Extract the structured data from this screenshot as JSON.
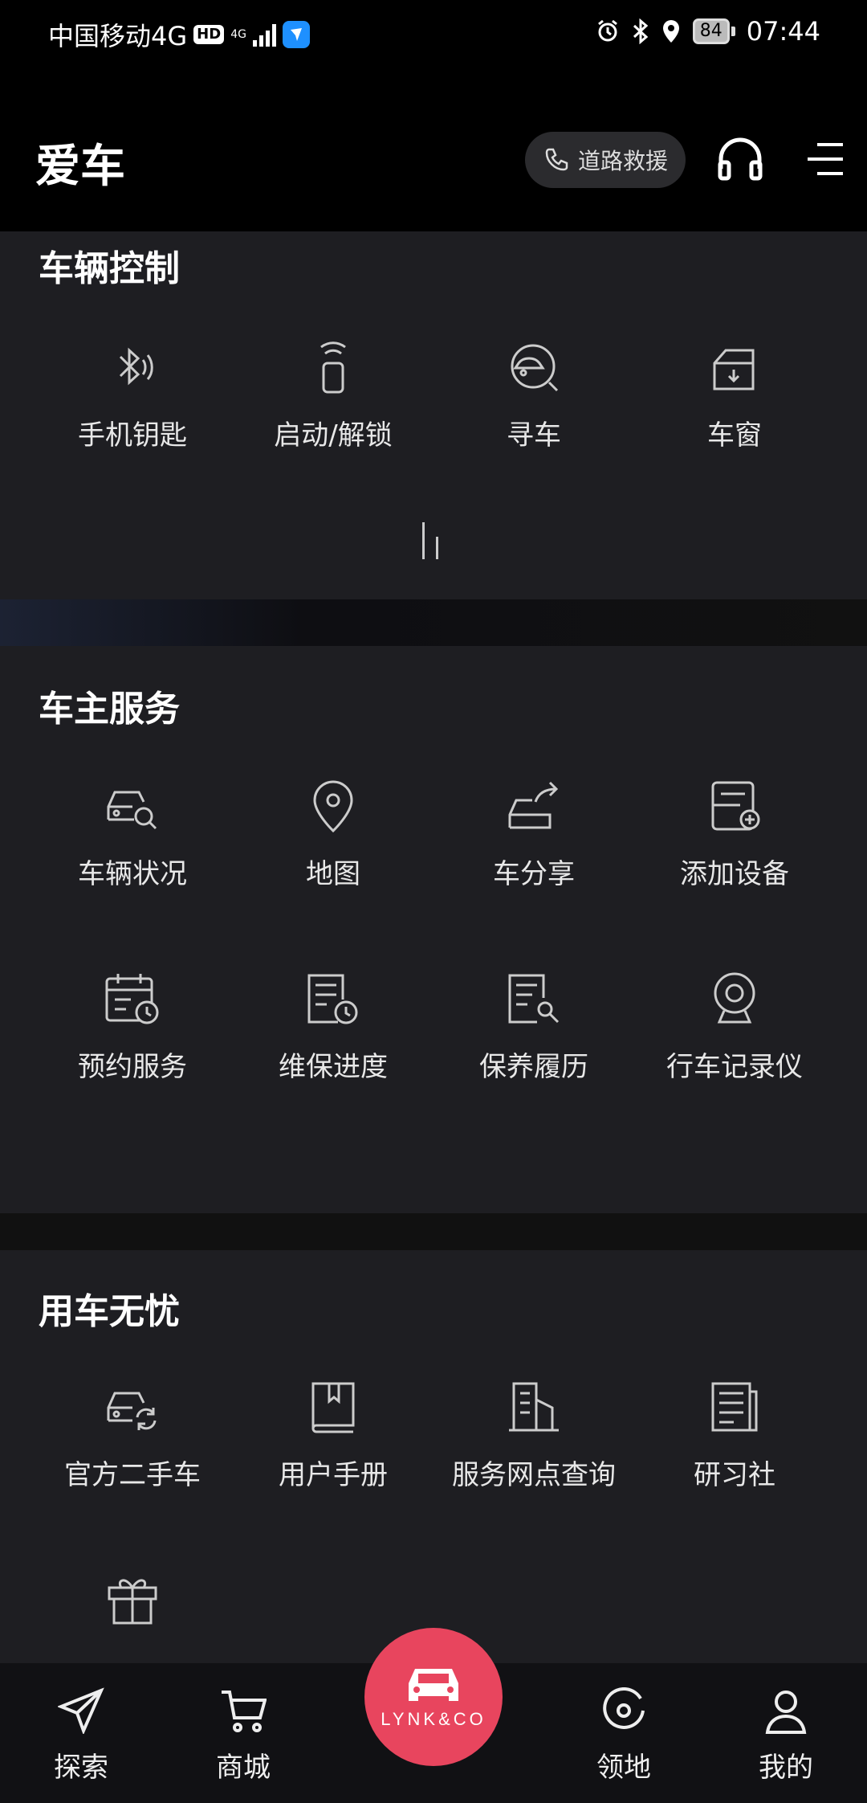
{
  "status_bar": {
    "carrier": "中国移动4G",
    "hd": "HD",
    "network": "4G",
    "battery": "84",
    "time": "07:44"
  },
  "header": {
    "title": "爱车",
    "rescue_label": "道路救援"
  },
  "vehicle_control": {
    "title": "车辆控制",
    "items": [
      {
        "label": "手机钥匙",
        "icon": "bluetooth-key-icon"
      },
      {
        "label": "启动/解锁",
        "icon": "remote-fob-icon"
      },
      {
        "label": "寻车",
        "icon": "find-car-icon"
      },
      {
        "label": "车窗",
        "icon": "car-window-icon"
      }
    ]
  },
  "owner_service": {
    "title": "车主服务",
    "items": [
      {
        "label": "车辆状况",
        "icon": "car-search-icon"
      },
      {
        "label": "地图",
        "icon": "map-pin-icon"
      },
      {
        "label": "车分享",
        "icon": "car-share-icon"
      },
      {
        "label": "添加设备",
        "icon": "add-device-icon"
      },
      {
        "label": "预约服务",
        "icon": "calendar-clock-icon"
      },
      {
        "label": "维保进度",
        "icon": "document-clock-icon"
      },
      {
        "label": "保养履历",
        "icon": "document-wrench-icon"
      },
      {
        "label": "行车记录仪",
        "icon": "dashcam-icon"
      }
    ]
  },
  "worry_free": {
    "title": "用车无忧",
    "items": [
      {
        "label": "官方二手车",
        "icon": "car-refresh-icon"
      },
      {
        "label": "用户手册",
        "icon": "book-icon"
      },
      {
        "label": "服务网点查询",
        "icon": "building-icon"
      },
      {
        "label": "研习社",
        "icon": "article-icon"
      },
      {
        "label": "",
        "icon": "gift-icon"
      }
    ]
  },
  "tab_bar": {
    "items": [
      {
        "label": "探索",
        "icon": "send-icon"
      },
      {
        "label": "商城",
        "icon": "cart-icon"
      },
      {
        "label": "领地",
        "icon": "target-icon"
      },
      {
        "label": "我的",
        "icon": "person-icon"
      }
    ],
    "center_label": "LYNK&CO"
  },
  "colors": {
    "background": "#000000",
    "panel": "#1e1e22",
    "accent": "#e8455e"
  }
}
